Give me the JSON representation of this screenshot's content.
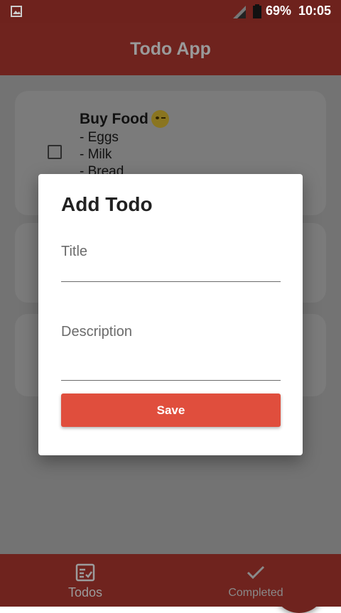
{
  "status_bar": {
    "battery": "69%",
    "time": "10:05"
  },
  "app_bar": {
    "title": "Todo App"
  },
  "todos": [
    {
      "title": "Buy Food",
      "emoji": "smirking-face-icon",
      "description": "- Eggs\n- Milk\n- Bread",
      "checked": false
    }
  ],
  "dialog": {
    "title": "Add Todo",
    "title_placeholder": "Title",
    "description_placeholder": "Description",
    "save_label": "Save"
  },
  "bottom_nav": {
    "items": [
      {
        "label": "Todos",
        "icon": "todo-list-icon",
        "active": true
      },
      {
        "label": "Completed",
        "icon": "checkmark-icon",
        "active": false
      }
    ]
  },
  "colors": {
    "primary": "#e04e3d",
    "app_bar_dimmed": "#6f231e",
    "scrim_background": "#737373"
  }
}
